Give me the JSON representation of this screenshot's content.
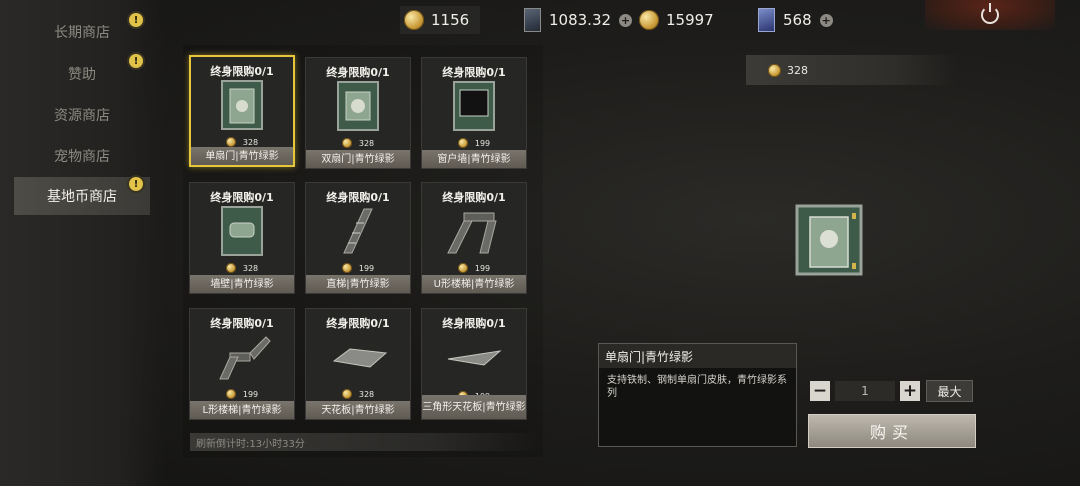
{
  "sidebar": {
    "items": [
      {
        "label": "长期商店",
        "badge": "!"
      },
      {
        "label": "赞助",
        "badge": "!"
      },
      {
        "label": "资源商店",
        "badge": ""
      },
      {
        "label": "宠物商店",
        "badge": ""
      },
      {
        "label": "基地币商店",
        "badge": "!"
      }
    ]
  },
  "currencies": {
    "gold": "1156",
    "card": "1083.32",
    "coin": "15997",
    "premium": "568"
  },
  "items": [
    {
      "limit": "终身限购0/1",
      "price": "328",
      "name": "单扇门|青竹绿影",
      "art": "door"
    },
    {
      "limit": "终身限购0/1",
      "price": "328",
      "name": "双扇门|青竹绿影",
      "art": "door2"
    },
    {
      "limit": "终身限购0/1",
      "price": "199",
      "name": "窗户墙|青竹绿影",
      "art": "window"
    },
    {
      "limit": "终身限购0/1",
      "price": "328",
      "name": "墙壁|青竹绿影",
      "art": "wall"
    },
    {
      "limit": "终身限购0/1",
      "price": "199",
      "name": "直梯|青竹绿影",
      "art": "stair"
    },
    {
      "limit": "终身限购0/1",
      "price": "199",
      "name": "U形楼梯|青竹绿影",
      "art": "ustair"
    },
    {
      "limit": "终身限购0/1",
      "price": "199",
      "name": "L形楼梯|青竹绿影",
      "art": "lstair"
    },
    {
      "limit": "终身限购0/1",
      "price": "328",
      "name": "天花板|青竹绿影",
      "art": "ceiling"
    },
    {
      "limit": "终身限购0/1",
      "price": "199",
      "name": "三角形天花板|青竹绿影",
      "art": "tri"
    }
  ],
  "refresh_text": "刷新倒计时:13小时33分",
  "detail": {
    "price": "328",
    "title": "单扇门|青竹绿影",
    "description": "支持铁制、钢制单扇门皮肤，青竹绿影系列",
    "quantity": "1",
    "max_label": "最大",
    "buy_label": "购买"
  }
}
